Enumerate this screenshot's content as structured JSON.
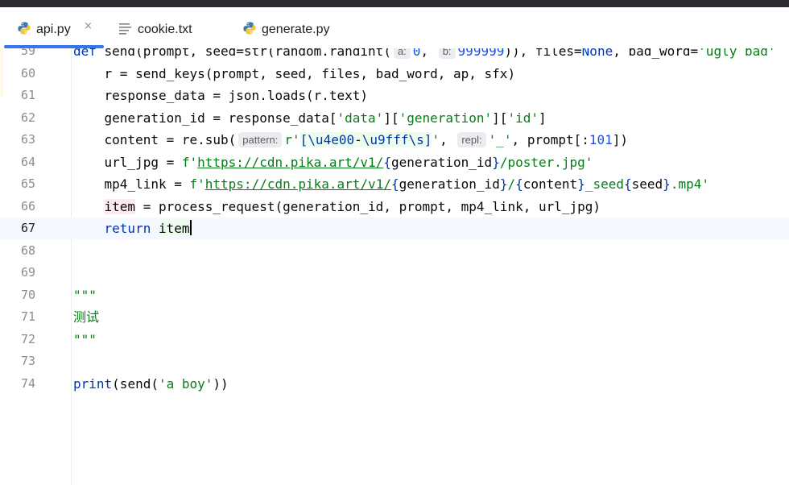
{
  "tabs": [
    {
      "label": "api.py",
      "icon": "python-icon",
      "active": true
    },
    {
      "label": "cookie.txt",
      "icon": "text-file-icon",
      "active": false
    },
    {
      "label": "generate.py",
      "icon": "python-icon",
      "active": false
    }
  ],
  "close_symbol": "×",
  "colors": {
    "accent": "#3574f0",
    "keyword": "#0033b3",
    "string": "#067d17",
    "number": "#1750eb"
  },
  "editor": {
    "lines": [
      {
        "num": "59",
        "tokens": [
          {
            "t": "def ",
            "c": "kw"
          },
          {
            "t": "send(prompt, seed=str(random.randint("
          },
          {
            "t": "a:",
            "c": "hint"
          },
          {
            "t": "0",
            "c": "num"
          },
          {
            "t": ", "
          },
          {
            "t": "b:",
            "c": "hint"
          },
          {
            "t": "999999",
            "c": "num"
          },
          {
            "t": ")), files="
          },
          {
            "t": "None",
            "c": "kw"
          },
          {
            "t": ", bad_word="
          },
          {
            "t": "'ugly bad'",
            "c": "str"
          }
        ]
      },
      {
        "num": "60",
        "tokens": [
          {
            "t": "    r = send_keys(prompt, seed, files, bad_word, ap, sfx)"
          }
        ]
      },
      {
        "num": "61",
        "tokens": [
          {
            "t": "    response_data = json.loads(r.text)"
          }
        ]
      },
      {
        "num": "62",
        "tokens": [
          {
            "t": "    generation_id = response_data["
          },
          {
            "t": "'data'",
            "c": "str"
          },
          {
            "t": "]["
          },
          {
            "t": "'generation'",
            "c": "str"
          },
          {
            "t": "]["
          },
          {
            "t": "'id'",
            "c": "str"
          },
          {
            "t": "]"
          }
        ]
      },
      {
        "num": "63",
        "tokens": [
          {
            "t": "    content = re.sub("
          },
          {
            "t": "pattern:",
            "c": "hint"
          },
          {
            "t": "r'",
            "c": "str"
          },
          {
            "t": "[",
            "c": "esc rxbg"
          },
          {
            "t": "\\u4e00",
            "c": "esc rxbg"
          },
          {
            "t": "-",
            "c": "rxbg"
          },
          {
            "t": "\\u9fff",
            "c": "esc rxbg"
          },
          {
            "t": "\\s",
            "c": "esc rxbg"
          },
          {
            "t": "]",
            "c": "esc rxbg"
          },
          {
            "t": "'",
            "c": "str"
          },
          {
            "t": ", "
          },
          {
            "t": "repl:",
            "c": "hint"
          },
          {
            "t": "'_'",
            "c": "str"
          },
          {
            "t": ", prompt[:"
          },
          {
            "t": "101",
            "c": "num"
          },
          {
            "t": "])"
          }
        ]
      },
      {
        "num": "64",
        "tokens": [
          {
            "t": "    url_jpg = "
          },
          {
            "t": "f'",
            "c": "str"
          },
          {
            "t": "https://cdn.pika.art/v1/",
            "c": "url"
          },
          {
            "t": "{",
            "c": "esc"
          },
          {
            "t": "generation_id"
          },
          {
            "t": "}",
            "c": "esc"
          },
          {
            "t": "/poster.jpg'",
            "c": "str"
          }
        ]
      },
      {
        "num": "65",
        "tokens": [
          {
            "t": "    mp4_link = "
          },
          {
            "t": "f'",
            "c": "str"
          },
          {
            "t": "https://cdn.pika.art/v1/",
            "c": "url"
          },
          {
            "t": "{",
            "c": "esc"
          },
          {
            "t": "generation_id"
          },
          {
            "t": "}",
            "c": "esc"
          },
          {
            "t": "/",
            "c": "str"
          },
          {
            "t": "{",
            "c": "esc"
          },
          {
            "t": "content"
          },
          {
            "t": "}",
            "c": "esc"
          },
          {
            "t": "_seed",
            "c": "str"
          },
          {
            "t": "{",
            "c": "esc"
          },
          {
            "t": "seed"
          },
          {
            "t": "}",
            "c": "esc"
          },
          {
            "t": ".mp4'",
            "c": "str"
          }
        ]
      },
      {
        "num": "66",
        "tokens": [
          {
            "t": "    "
          },
          {
            "t": "item",
            "c": "warnbg"
          },
          {
            "t": " = process_request(generation_id, prompt, mp4_link, url_jpg)"
          }
        ]
      },
      {
        "num": "67",
        "current": true,
        "tokens": [
          {
            "t": "    "
          },
          {
            "t": "return",
            "c": "kw"
          },
          {
            "t": " "
          },
          {
            "t": "item",
            "c": "rxbg"
          },
          {
            "t": "",
            "c": "caret"
          }
        ]
      },
      {
        "num": "68",
        "tokens": []
      },
      {
        "num": "69",
        "tokens": []
      },
      {
        "num": "70",
        "tokens": [
          {
            "t": "\"\"\"",
            "c": "str"
          }
        ]
      },
      {
        "num": "71",
        "tokens": [
          {
            "t": "测试",
            "c": "cjk"
          }
        ]
      },
      {
        "num": "72",
        "tokens": [
          {
            "t": "\"\"\"",
            "c": "str"
          }
        ]
      },
      {
        "num": "73",
        "tokens": []
      },
      {
        "num": "74",
        "tokens": [
          {
            "t": "print",
            "c": "kw"
          },
          {
            "t": "(send("
          },
          {
            "t": "'a boy'",
            "c": "str"
          },
          {
            "t": "))"
          }
        ]
      }
    ]
  }
}
